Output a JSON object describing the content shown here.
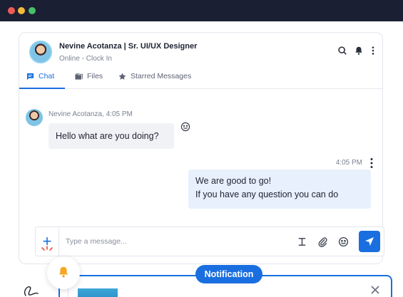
{
  "window": {
    "controls": [
      "close",
      "minimize",
      "maximize"
    ]
  },
  "header": {
    "name": "Nevine Acotanza | Sr. UI/UX Designer",
    "status": "Online -  Clock In",
    "icons": [
      "search-icon",
      "bell-icon",
      "more-vertical-icon"
    ]
  },
  "tabs": [
    {
      "label": "Chat",
      "icon": "chat-icon",
      "active": true
    },
    {
      "label": "Files",
      "icon": "folder-icon",
      "active": false
    },
    {
      "label": "Starred Messages",
      "icon": "star-icon",
      "active": false
    }
  ],
  "messages": [
    {
      "sender_line": "Nevine Acotanza, 4:05 PM",
      "text": "Hello what are you doing?",
      "direction": "incoming"
    },
    {
      "time": "4:05 PM",
      "lines": [
        "We are good to go!",
        "If you have any question you can do"
      ],
      "direction": "outgoing"
    }
  ],
  "composer": {
    "placeholder": "Type a message...",
    "icons": [
      "text-format-icon",
      "attachment-icon",
      "emoji-icon",
      "send-icon"
    ]
  },
  "notification": {
    "label": "Notification"
  },
  "colors": {
    "accent": "#1a6fe0",
    "titlebar": "#1b1f33",
    "incoming_bubble": "#f1f2f6",
    "outgoing_bubble": "#e8f0fd",
    "bell": "#f5a623"
  }
}
